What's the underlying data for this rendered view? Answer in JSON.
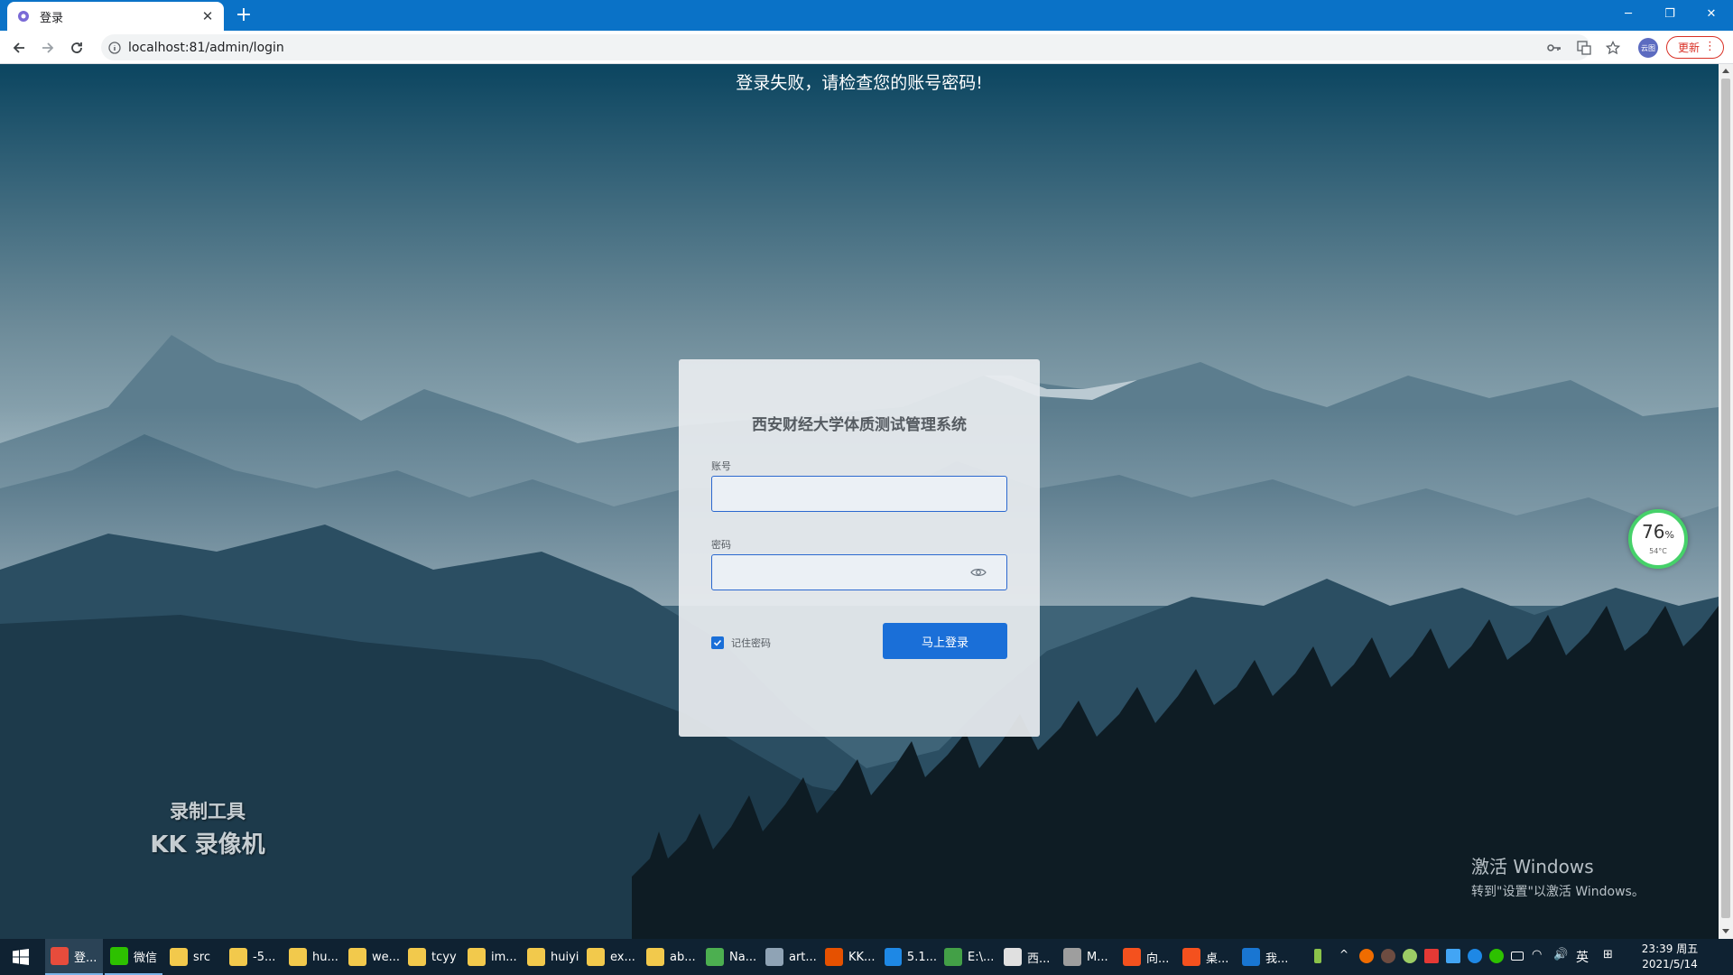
{
  "browser": {
    "tab_title": "登录",
    "new_tab_icon": "plus-icon",
    "url": "localhost:81/admin/login",
    "profile_label": "云图",
    "update_label": "更新"
  },
  "page": {
    "error_message": "登录失败，请检查您的账号密码!",
    "login": {
      "title": "西安财经大学体质测试管理系统",
      "account_label": "账号",
      "account_value": "",
      "password_label": "密码",
      "password_value": "",
      "remember_label": "记住密码",
      "remember_checked": true,
      "submit_label": "马上登录"
    },
    "watermark": {
      "line1": "录制工具",
      "line2": "KK 录像机"
    },
    "activation": {
      "title": "激活 Windows",
      "subtitle": "转到\"设置\"以激活 Windows。"
    },
    "monitor": {
      "percent": "76",
      "percent_unit": "%",
      "temperature": "54°C"
    }
  },
  "taskbar": {
    "items": [
      {
        "label": "登...",
        "icon": "chrome-icon",
        "color": "#e74c3c"
      },
      {
        "label": "微信",
        "icon": "wechat-icon",
        "color": "#2dc100"
      },
      {
        "label": "src",
        "icon": "folder-icon",
        "color": "#f2c94c"
      },
      {
        "label": "-5...",
        "icon": "folder-icon",
        "color": "#f2c94c"
      },
      {
        "label": "hu...",
        "icon": "folder-icon",
        "color": "#f2c94c"
      },
      {
        "label": "we...",
        "icon": "folder-icon",
        "color": "#f2c94c"
      },
      {
        "label": "tcyy",
        "icon": "folder-icon",
        "color": "#f2c94c"
      },
      {
        "label": "im...",
        "icon": "folder-icon",
        "color": "#f2c94c"
      },
      {
        "label": "huiyi",
        "icon": "folder-icon",
        "color": "#f2c94c"
      },
      {
        "label": "ex...",
        "icon": "folder-icon",
        "color": "#f2c94c"
      },
      {
        "label": "ab...",
        "icon": "folder-icon",
        "color": "#f2c94c"
      },
      {
        "label": "Na...",
        "icon": "navicat-icon",
        "color": "#4caf50"
      },
      {
        "label": "art...",
        "icon": "app-icon",
        "color": "#8fa3b5"
      },
      {
        "label": "KK...",
        "icon": "kk-recorder-icon",
        "color": "#e65100"
      },
      {
        "label": "5.1...",
        "icon": "vscode-icon",
        "color": "#1e88e5"
      },
      {
        "label": "E:\\...",
        "icon": "notepad-icon",
        "color": "#43a047"
      },
      {
        "label": "西...",
        "icon": "chat-icon",
        "color": "#e0e0e0"
      },
      {
        "label": "M...",
        "icon": "pen-icon",
        "color": "#9e9e9e"
      },
      {
        "label": "向...",
        "icon": "slides-icon",
        "color": "#f4511e"
      },
      {
        "label": "桌...",
        "icon": "slides-icon",
        "color": "#f4511e"
      },
      {
        "label": "我...",
        "icon": "phone-icon",
        "color": "#1976d2"
      }
    ],
    "ime": "英",
    "time": "23:39 周五",
    "date": "2021/5/14"
  },
  "colors": {
    "accent": "#1a6fd8",
    "tabstrip": "#0a72c7",
    "taskbar": "#0f2232",
    "error_text": "#ffffff"
  }
}
